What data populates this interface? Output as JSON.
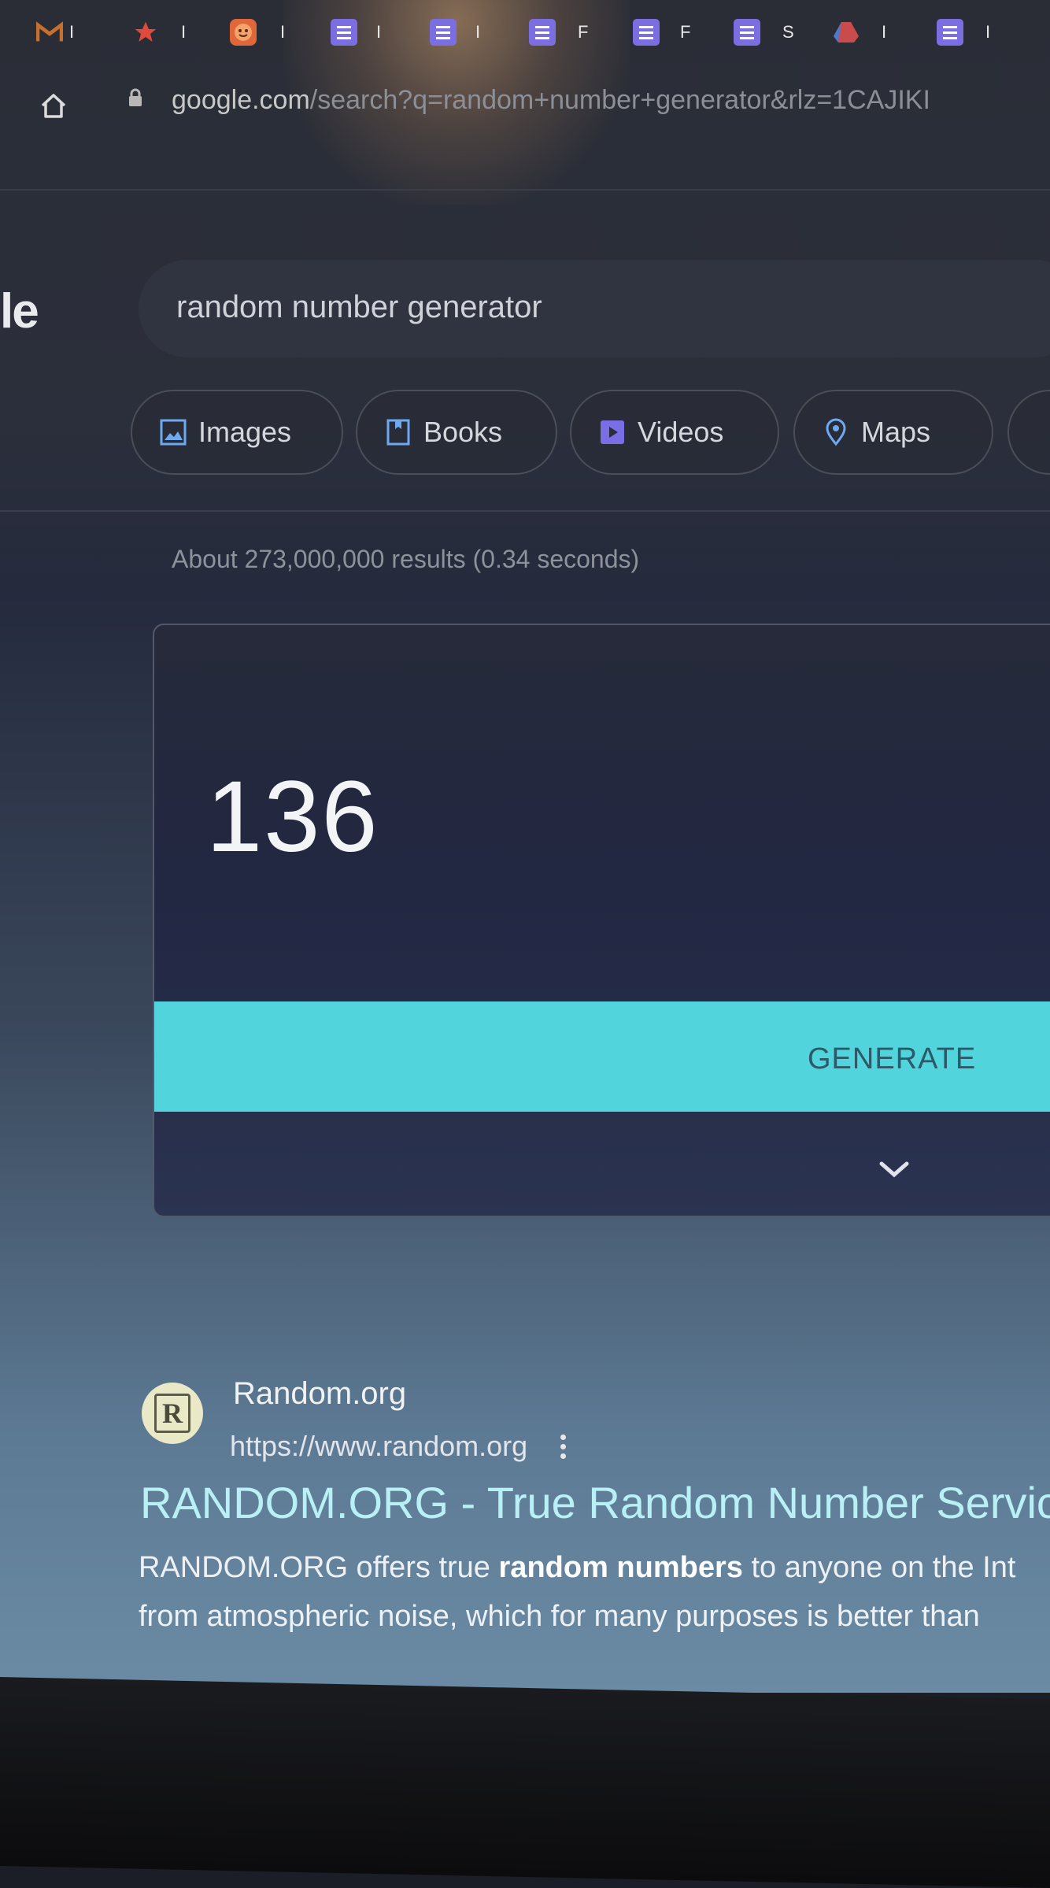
{
  "browser": {
    "bookmarks": [
      {
        "icon": "gmail-icon",
        "label": "I"
      },
      {
        "icon": "star-icon",
        "label": "I"
      },
      {
        "icon": "face-icon",
        "label": "I"
      },
      {
        "icon": "doc-icon",
        "label": "I"
      },
      {
        "icon": "doc-icon",
        "label": "I"
      },
      {
        "icon": "doc-icon",
        "label": "F"
      },
      {
        "icon": "doc-icon",
        "label": "F"
      },
      {
        "icon": "doc-icon",
        "label": "S"
      },
      {
        "icon": "drive-icon",
        "label": "I"
      },
      {
        "icon": "doc-icon",
        "label": "I"
      }
    ],
    "url_host": "google.com",
    "url_path": "/search?q=random+number+generator&rlz=1CAJIKI"
  },
  "search": {
    "logo_fragment": "le",
    "query": "random number generator",
    "chips": [
      {
        "label": "Images",
        "icon": "image-icon"
      },
      {
        "label": "Books",
        "icon": "book-icon"
      },
      {
        "label": "Videos",
        "icon": "video-icon"
      },
      {
        "label": "Maps",
        "icon": "map-pin-icon"
      }
    ],
    "result_stats": "About 273,000,000 results (0.34 seconds)"
  },
  "generator": {
    "result": "136",
    "button_label": "GENERATE",
    "colors": {
      "button": "#52d4dc",
      "button_text": "#2c5a6a"
    }
  },
  "results": [
    {
      "site_name": "Random.org",
      "favicon_letter": "R",
      "url": "https://www.random.org",
      "title": "RANDOM.ORG - True Random Number Servic",
      "snippet_line1_pre": "RANDOM.ORG offers true ",
      "snippet_line1_bold": "random numbers",
      "snippet_line1_post": " to anyone on the Int",
      "snippet_line2": "from atmospheric noise, which for many purposes is better than"
    }
  ]
}
